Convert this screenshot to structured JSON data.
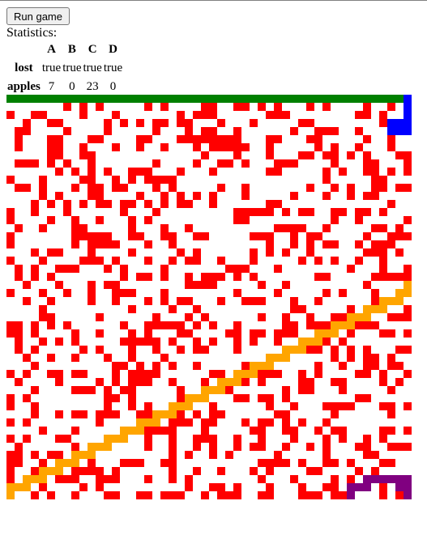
{
  "run_button": {
    "label": "Run game"
  },
  "stats_label": "Statistics:",
  "stats": {
    "columns": [
      "A",
      "B",
      "C",
      "D"
    ],
    "rows": [
      {
        "label": "lost",
        "values": [
          "true",
          "true",
          "true",
          "true"
        ]
      },
      {
        "label": "apples",
        "values": [
          "7",
          "0",
          "23",
          "0"
        ]
      }
    ]
  },
  "board": {
    "size": 50,
    "colors": {
      "empty": "#ffffff",
      "apple": "#ff0000",
      "A": "#008000",
      "B": "#0000ff",
      "C": "#ffa500",
      "D": "#800080"
    },
    "snakes": {
      "A": [
        [
          0,
          0
        ],
        [
          1,
          0
        ],
        [
          2,
          0
        ],
        [
          3,
          0
        ],
        [
          4,
          0
        ],
        [
          5,
          0
        ],
        [
          6,
          0
        ],
        [
          7,
          0
        ],
        [
          8,
          0
        ],
        [
          9,
          0
        ],
        [
          10,
          0
        ],
        [
          11,
          0
        ],
        [
          12,
          0
        ],
        [
          13,
          0
        ],
        [
          14,
          0
        ],
        [
          15,
          0
        ],
        [
          16,
          0
        ],
        [
          17,
          0
        ],
        [
          18,
          0
        ],
        [
          19,
          0
        ],
        [
          20,
          0
        ],
        [
          21,
          0
        ],
        [
          22,
          0
        ],
        [
          23,
          0
        ],
        [
          24,
          0
        ],
        [
          25,
          0
        ],
        [
          26,
          0
        ],
        [
          27,
          0
        ],
        [
          28,
          0
        ],
        [
          29,
          0
        ],
        [
          30,
          0
        ],
        [
          31,
          0
        ],
        [
          32,
          0
        ],
        [
          33,
          0
        ],
        [
          34,
          0
        ],
        [
          35,
          0
        ],
        [
          36,
          0
        ],
        [
          37,
          0
        ],
        [
          38,
          0
        ],
        [
          39,
          0
        ],
        [
          40,
          0
        ],
        [
          41,
          0
        ],
        [
          42,
          0
        ],
        [
          43,
          0
        ],
        [
          44,
          0
        ],
        [
          45,
          0
        ],
        [
          46,
          0
        ],
        [
          47,
          0
        ],
        [
          48,
          0
        ]
      ],
      "B": [
        [
          49,
          0
        ],
        [
          49,
          1
        ],
        [
          49,
          2
        ],
        [
          49,
          3
        ],
        [
          48,
          3
        ],
        [
          47,
          3
        ],
        [
          47,
          4
        ],
        [
          48,
          4
        ],
        [
          49,
          4
        ]
      ],
      "C": [
        [
          0,
          49
        ],
        [
          0,
          48
        ],
        [
          1,
          48
        ],
        [
          2,
          48
        ],
        [
          2,
          47
        ],
        [
          3,
          47
        ],
        [
          4,
          47
        ],
        [
          4,
          46
        ],
        [
          5,
          46
        ],
        [
          6,
          46
        ],
        [
          6,
          45
        ],
        [
          7,
          45
        ],
        [
          8,
          45
        ],
        [
          8,
          44
        ],
        [
          9,
          44
        ],
        [
          10,
          44
        ],
        [
          10,
          43
        ],
        [
          11,
          43
        ],
        [
          12,
          43
        ],
        [
          12,
          42
        ],
        [
          13,
          42
        ],
        [
          14,
          42
        ],
        [
          14,
          41
        ],
        [
          15,
          41
        ],
        [
          16,
          41
        ],
        [
          16,
          40
        ],
        [
          17,
          40
        ],
        [
          18,
          40
        ],
        [
          18,
          39
        ],
        [
          19,
          39
        ],
        [
          20,
          39
        ],
        [
          20,
          38
        ],
        [
          21,
          38
        ],
        [
          22,
          38
        ],
        [
          22,
          37
        ],
        [
          23,
          37
        ],
        [
          24,
          37
        ],
        [
          24,
          36
        ],
        [
          25,
          36
        ],
        [
          26,
          36
        ],
        [
          26,
          35
        ],
        [
          27,
          35
        ],
        [
          28,
          35
        ],
        [
          28,
          34
        ],
        [
          29,
          34
        ],
        [
          30,
          34
        ],
        [
          30,
          33
        ],
        [
          31,
          33
        ],
        [
          32,
          33
        ],
        [
          32,
          32
        ],
        [
          33,
          32
        ],
        [
          34,
          32
        ],
        [
          34,
          31
        ],
        [
          35,
          31
        ],
        [
          36,
          31
        ],
        [
          36,
          30
        ],
        [
          37,
          30
        ],
        [
          38,
          30
        ],
        [
          38,
          29
        ],
        [
          39,
          29
        ],
        [
          40,
          29
        ],
        [
          40,
          28
        ],
        [
          41,
          28
        ],
        [
          42,
          28
        ],
        [
          42,
          27
        ],
        [
          43,
          27
        ],
        [
          44,
          27
        ],
        [
          44,
          26
        ],
        [
          45,
          26
        ],
        [
          46,
          26
        ],
        [
          46,
          25
        ],
        [
          47,
          25
        ],
        [
          48,
          25
        ],
        [
          48,
          24
        ],
        [
          49,
          24
        ],
        [
          49,
          23
        ]
      ],
      "D": [
        [
          42,
          49
        ],
        [
          42,
          48
        ],
        [
          43,
          48
        ],
        [
          44,
          48
        ],
        [
          44,
          47
        ],
        [
          45,
          47
        ],
        [
          46,
          47
        ],
        [
          47,
          47
        ],
        [
          48,
          47
        ],
        [
          49,
          47
        ],
        [
          49,
          48
        ],
        [
          49,
          49
        ],
        [
          48,
          48
        ]
      ]
    },
    "apple_density": 0.33,
    "apple_seed": 20240611
  }
}
